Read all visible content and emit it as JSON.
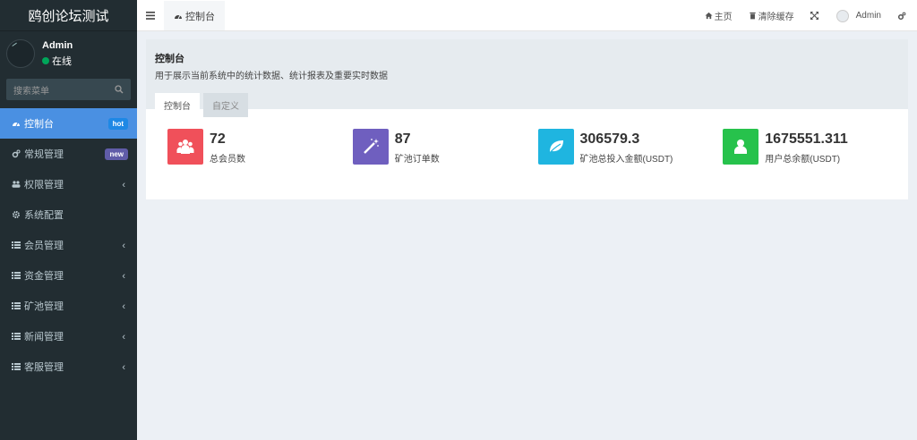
{
  "sidebar": {
    "logo": "鸥创论坛测试",
    "user": {
      "name": "Admin",
      "status": "在线"
    },
    "search_placeholder": "搜索菜单",
    "items": [
      {
        "label": "控制台",
        "icon": "dashboard-icon",
        "badge": "hot",
        "active": true
      },
      {
        "label": "常规管理",
        "icon": "cogs-icon",
        "badge": "new"
      },
      {
        "label": "权限管理",
        "icon": "users-icon",
        "chevron": true
      },
      {
        "label": "系统配置",
        "icon": "gear-icon"
      },
      {
        "label": "会员管理",
        "icon": "list-icon",
        "chevron": true
      },
      {
        "label": "资金管理",
        "icon": "list-icon",
        "chevron": true
      },
      {
        "label": "矿池管理",
        "icon": "list-icon",
        "chevron": true
      },
      {
        "label": "新闻管理",
        "icon": "list-icon",
        "chevron": true
      },
      {
        "label": "客服管理",
        "icon": "list-icon",
        "chevron": true
      }
    ]
  },
  "topbar": {
    "tab_label": "控制台",
    "home_label": "主页",
    "clear_cache_label": "清除缓存",
    "admin_label": "Admin"
  },
  "header": {
    "title": "控制台",
    "description": "用于展示当前系统中的统计数据、统计报表及重要实时数据",
    "tabs": [
      "控制台",
      "自定义"
    ]
  },
  "stats": [
    {
      "value": "72",
      "label": "总会员数",
      "color": "#f0505a",
      "icon": "users-icon"
    },
    {
      "value": "87",
      "label": "矿池订单数",
      "color": "#6f5fbf",
      "icon": "magic-wand-icon"
    },
    {
      "value": "306579.3",
      "label": "矿池总投入金额(USDT)",
      "color": "#1fb5e0",
      "icon": "leaf-icon"
    },
    {
      "value": "1675551.311",
      "label": "用户总余额(USDT)",
      "color": "#27c24c",
      "icon": "user-icon"
    }
  ]
}
